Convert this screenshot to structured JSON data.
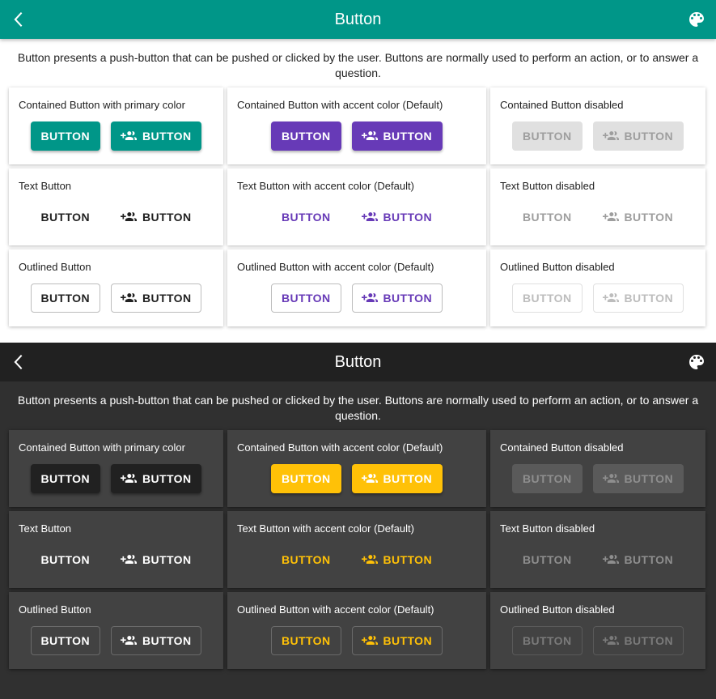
{
  "app_title": "Button",
  "description": "Button presents a push-button that can be pushed or clicked by the user. Buttons are normally used to perform an action, or to answer a question.",
  "button_label": "BUTTON",
  "icons": {
    "back": "chevron-left-icon",
    "palette": "palette-icon",
    "button": "group-add-icon"
  },
  "cards": [
    {
      "title": "Contained Button with primary color"
    },
    {
      "title": "Contained Button with accent color (Default)"
    },
    {
      "title": "Contained Button disabled"
    },
    {
      "title": "Text Button"
    },
    {
      "title": "Text Button with accent color (Default)"
    },
    {
      "title": "Text Button disabled"
    },
    {
      "title": "Outlined Button"
    },
    {
      "title": "Outlined Button with accent color (Default)"
    },
    {
      "title": "Outlined Button disabled"
    }
  ],
  "themes": {
    "light": {
      "appbar": "#009688",
      "background": "#ffffff",
      "primary": "#009688",
      "accent": "#673ab7"
    },
    "dark": {
      "appbar": "#212121",
      "background": "#303030",
      "primary": "#212121",
      "accent": "#ffc107"
    }
  }
}
